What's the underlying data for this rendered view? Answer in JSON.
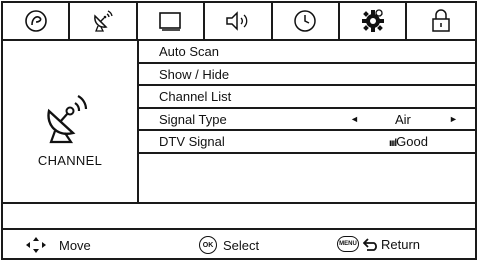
{
  "tabs": [
    {
      "icon": "picture-icon"
    },
    {
      "icon": "channel-dish-icon"
    },
    {
      "icon": "screen-icon"
    },
    {
      "icon": "sound-icon"
    },
    {
      "icon": "clock-icon"
    },
    {
      "icon": "setup-gear-icon"
    },
    {
      "icon": "lock-icon"
    }
  ],
  "panel": {
    "label": "CHANNEL",
    "icon": "satellite-dish-icon"
  },
  "menu": {
    "items": [
      {
        "label": "Auto Scan"
      },
      {
        "label": "Show / Hide"
      },
      {
        "label": "Channel List"
      },
      {
        "label": "Signal Type",
        "value": "Air",
        "left_arrow": "◄",
        "right_arrow": "►"
      },
      {
        "label": "DTV Signal",
        "value": "Good",
        "signal_bars": "ıııl"
      }
    ]
  },
  "footer": {
    "move": {
      "label": "Move",
      "icon": "dpad-icon"
    },
    "select": {
      "label": "Select",
      "button": "OK"
    },
    "return": {
      "label": "Return",
      "button": "MENU",
      "icon": "return-arrow-icon"
    }
  },
  "colors": {
    "line": "#1a1a1a",
    "background": "#ffffff",
    "text": "#111111"
  }
}
